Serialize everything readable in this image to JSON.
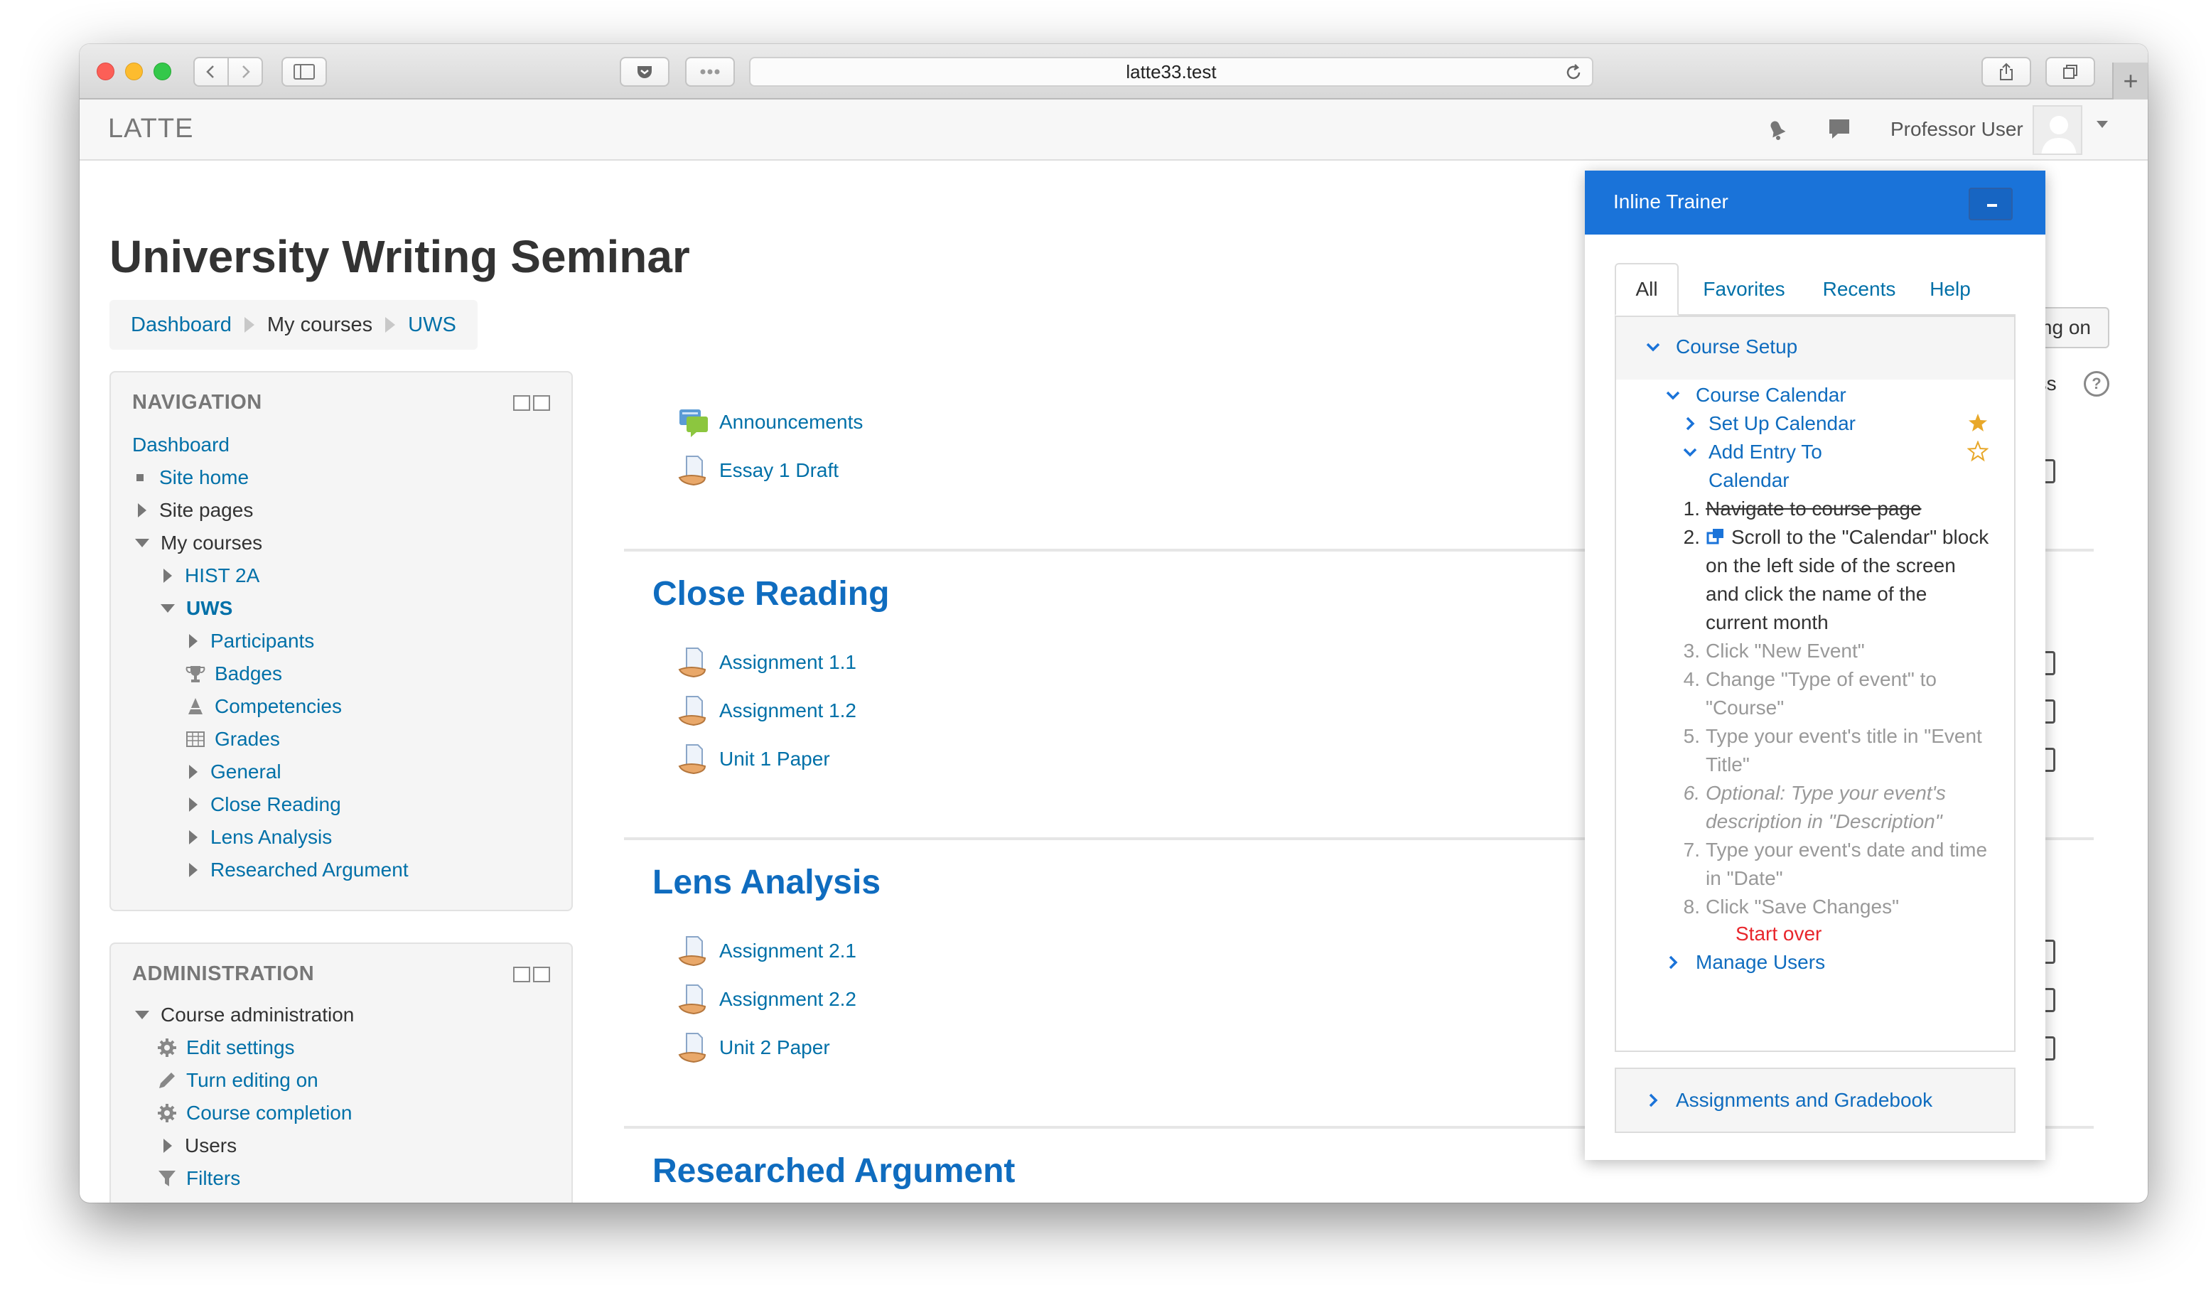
{
  "browser": {
    "url": "latte33.test",
    "colors": {
      "close": "#fc5f57",
      "minimize": "#fdbc2e",
      "maximize": "#34c84a"
    }
  },
  "navbar": {
    "brand": "LATTE",
    "user_name": "Professor User",
    "icons": [
      "bell-icon",
      "chat-icon",
      "avatar",
      "chevron-down-icon"
    ]
  },
  "page": {
    "title": "University Writing Seminar",
    "breadcrumb": [
      "Dashboard",
      "My courses",
      "UWS"
    ]
  },
  "navigation": {
    "title": "NAVIGATION",
    "items": [
      {
        "label": "Dashboard"
      },
      {
        "label": "Site home"
      },
      {
        "label": "Site pages"
      },
      {
        "label": "My courses"
      },
      {
        "label": "HIST 2A"
      },
      {
        "label": "UWS"
      },
      {
        "label": "Participants"
      },
      {
        "label": "Badges"
      },
      {
        "label": "Competencies"
      },
      {
        "label": "Grades"
      },
      {
        "label": "General"
      },
      {
        "label": "Close Reading"
      },
      {
        "label": "Lens Analysis"
      },
      {
        "label": "Researched Argument"
      }
    ]
  },
  "administration": {
    "title": "ADMINISTRATION",
    "items": [
      {
        "label": "Course administration"
      },
      {
        "label": "Edit settings"
      },
      {
        "label": "Turn editing on"
      },
      {
        "label": "Course completion"
      },
      {
        "label": "Users"
      },
      {
        "label": "Filters"
      }
    ]
  },
  "main": {
    "general_activities": [
      "Announcements",
      "Essay 1 Draft"
    ],
    "sections": [
      {
        "title": "Close Reading",
        "activities": [
          "Assignment 1.1",
          "Assignment 1.2",
          "Unit 1 Paper"
        ]
      },
      {
        "title": "Lens Analysis",
        "activities": [
          "Assignment 2.1",
          "Assignment 2.2",
          "Unit 2 Paper"
        ]
      },
      {
        "title": "Researched Argument"
      }
    ],
    "edit_button_partial": "ing on",
    "progress_partial": "ess"
  },
  "trainer": {
    "title": "Inline Trainer",
    "tabs": [
      "All",
      "Favorites",
      "Recents",
      "Help"
    ],
    "active_tab": "All",
    "course_setup": "Course Setup",
    "course_calendar": "Course Calendar",
    "set_up_calendar": "Set Up Calendar",
    "add_entry_line1": "Add Entry To",
    "add_entry_line2": "Calendar",
    "steps": [
      {
        "num": "1.",
        "text": "Navigate to course page"
      },
      {
        "num": "2.",
        "text": "Scroll to the \"Calendar\" block on the left side of the screen and click the name of the current month"
      },
      {
        "num": "3.",
        "text": "Click \"New Event\""
      },
      {
        "num": "4.",
        "text": "Change \"Type of event\" to \"Course\""
      },
      {
        "num": "5.",
        "text": "Type your event's title in \"Event Title\""
      },
      {
        "num": "6.",
        "text": "Optional: Type your event's description in \"Description\""
      },
      {
        "num": "7.",
        "text": "Type your event's date and time in \"Date\""
      },
      {
        "num": "8.",
        "text": "Click \"Save Changes\""
      }
    ],
    "start_over": "Start over",
    "manage_users": "Manage Users",
    "assignments_gradebook": "Assignments and Gradebook",
    "colors": {
      "header": "#1a73d9",
      "start_over": "#e8262c",
      "favorite_star": "#e8a82a"
    }
  }
}
